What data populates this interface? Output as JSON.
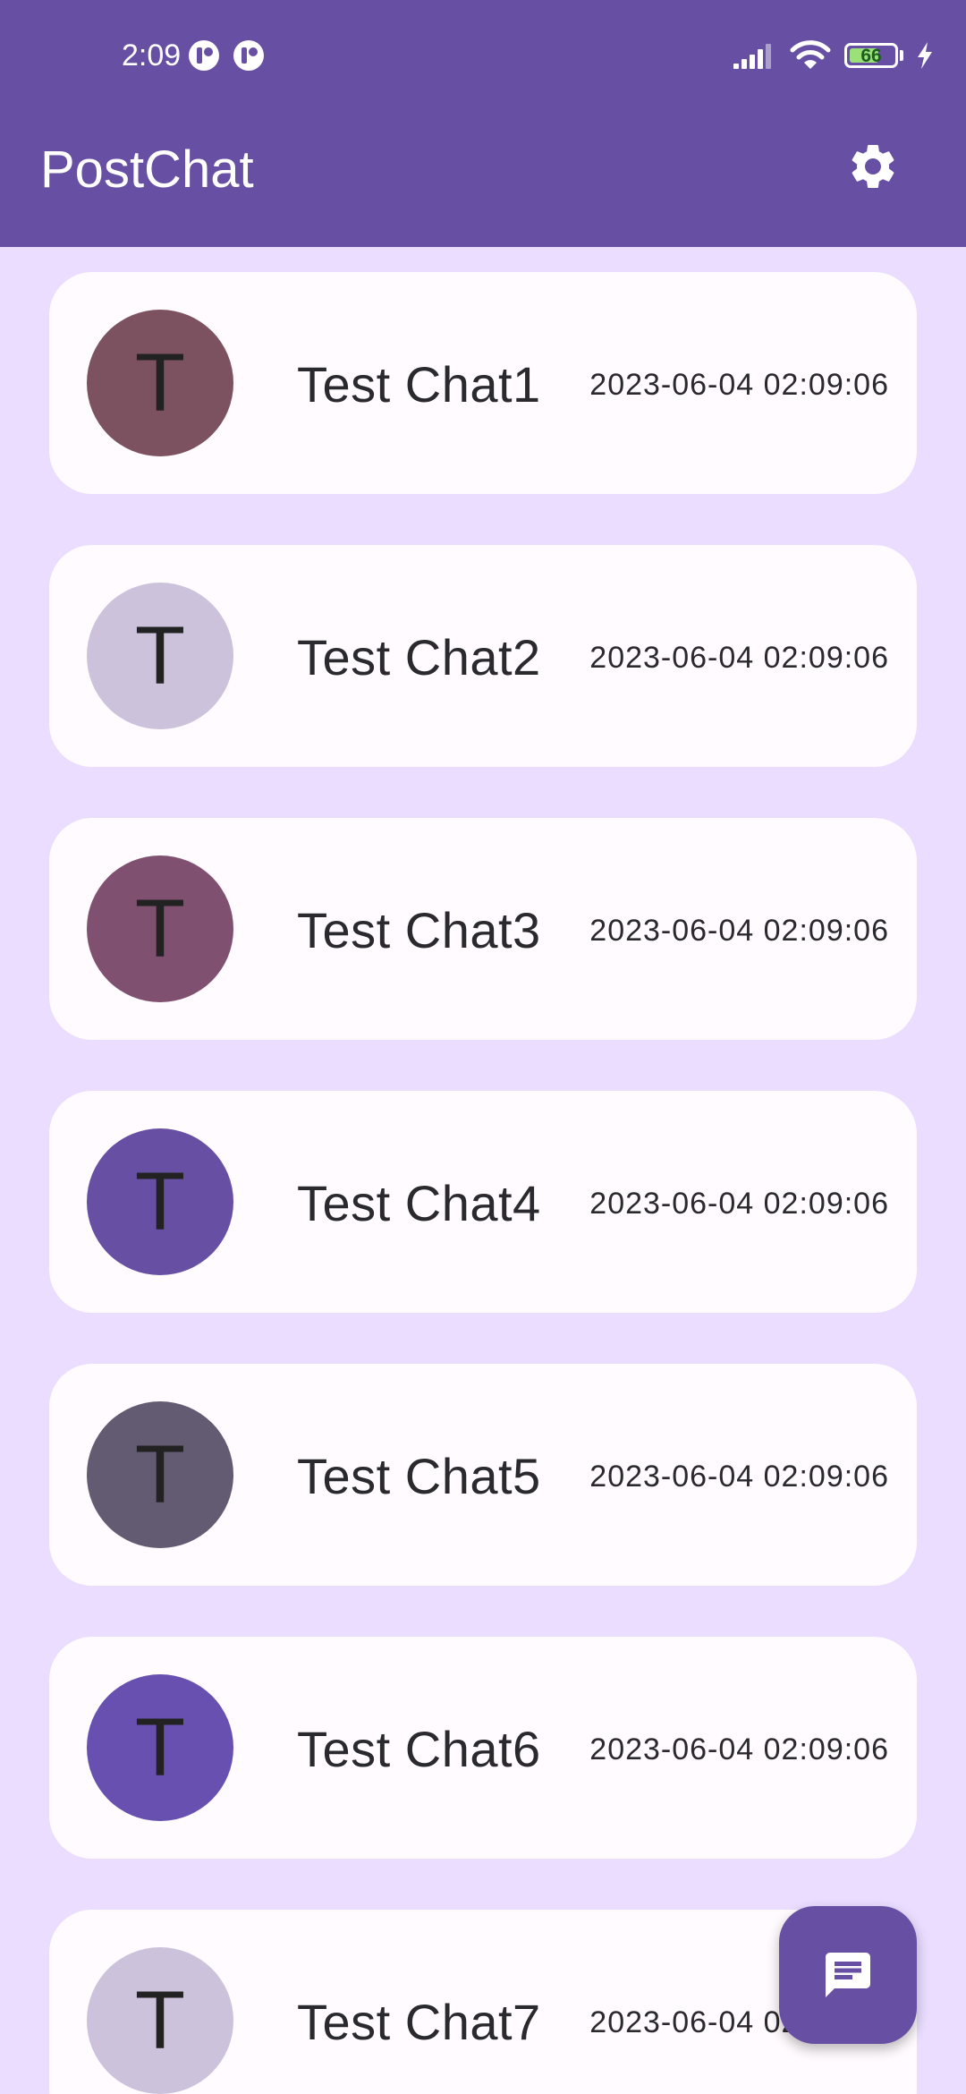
{
  "status_bar": {
    "time": "2:09",
    "battery_level": "66",
    "battery_fill_percent": 66,
    "icons": [
      "notification-icon",
      "notification-icon",
      "signal-icon",
      "wifi-icon",
      "battery-icon",
      "charging-icon"
    ]
  },
  "app_bar": {
    "title": "PostChat",
    "settings_icon": "gear-icon"
  },
  "chats": [
    {
      "initial": "T",
      "name": "Test Chat1",
      "timestamp": "2023-06-04 02:09:06",
      "avatar_color": "#7d5260"
    },
    {
      "initial": "T",
      "name": "Test Chat2",
      "timestamp": "2023-06-04 02:09:06",
      "avatar_color": "#ccc2dc"
    },
    {
      "initial": "T",
      "name": "Test Chat3",
      "timestamp": "2023-06-04 02:09:06",
      "avatar_color": "#7f5070"
    },
    {
      "initial": "T",
      "name": "Test Chat4",
      "timestamp": "2023-06-04 02:09:06",
      "avatar_color": "#6750a4"
    },
    {
      "initial": "T",
      "name": "Test Chat5",
      "timestamp": "2023-06-04 02:09:06",
      "avatar_color": "#625b71"
    },
    {
      "initial": "T",
      "name": "Test Chat6",
      "timestamp": "2023-06-04 02:09:06",
      "avatar_color": "#6750b0"
    },
    {
      "initial": "T",
      "name": "Test Chat7",
      "timestamp": "2023-06-04 02:09:06",
      "avatar_color": "#ccc2dc"
    }
  ],
  "fab": {
    "icon": "message-icon"
  },
  "colors": {
    "primary": "#6750a4",
    "background": "#eaddff",
    "surface": "#fffbfe",
    "on_primary": "#ffffff"
  }
}
